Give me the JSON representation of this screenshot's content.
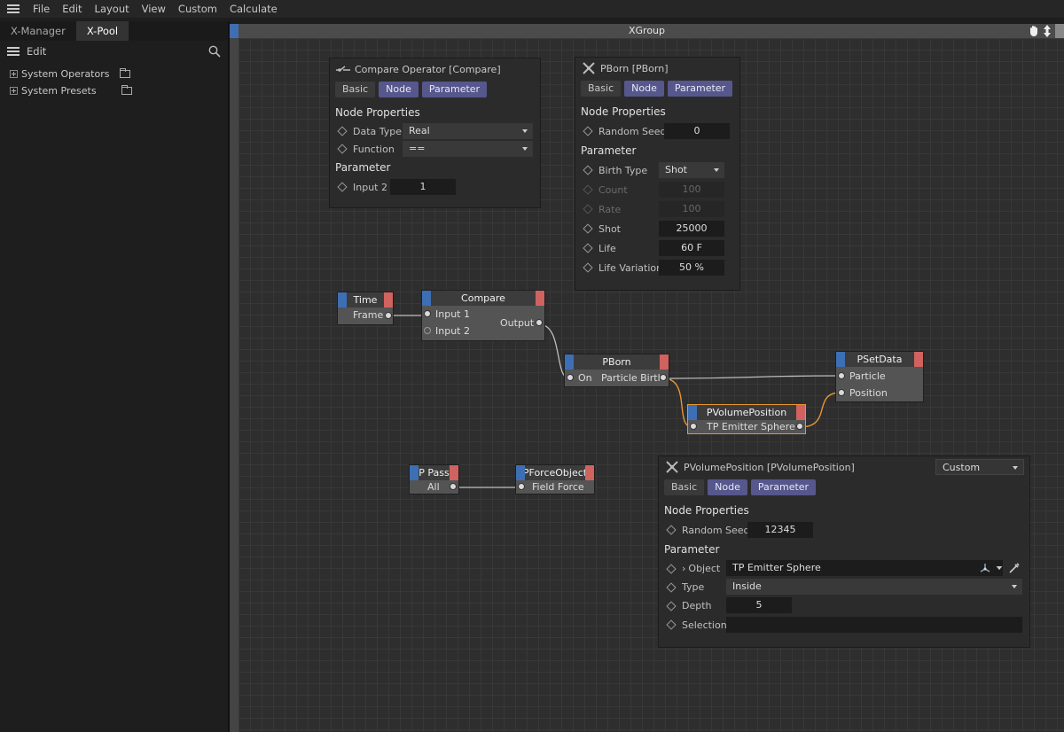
{
  "menubar": {
    "items": [
      "File",
      "Edit",
      "Layout",
      "View",
      "Custom",
      "Calculate"
    ]
  },
  "left": {
    "tabs": [
      "X-Manager",
      "X-Pool"
    ],
    "edit_label": "Edit",
    "tree": [
      "System Operators",
      "System Presets"
    ]
  },
  "xgroup": {
    "title": "XGroup"
  },
  "compare_panel": {
    "title": "Compare Operator [Compare]",
    "tabs": [
      "Basic",
      "Node",
      "Parameter"
    ],
    "section1": "Node Properties",
    "data_type_label": "Data Type",
    "data_type_value": "Real",
    "function_label": "Function",
    "function_value": "==",
    "section2": "Parameter",
    "input2_label": "Input 2",
    "input2_value": "1"
  },
  "pborn_panel": {
    "title": "PBorn [PBorn]",
    "tabs": [
      "Basic",
      "Node",
      "Parameter"
    ],
    "section1": "Node Properties",
    "seed_label": "Random Seed",
    "seed_value": "0",
    "section2": "Parameter",
    "birth_type_label": "Birth Type",
    "birth_type_value": "Shot",
    "count_label": "Count",
    "count_value": "100",
    "rate_label": "Rate",
    "rate_value": "100",
    "shot_label": "Shot",
    "shot_value": "25000",
    "life_label": "Life",
    "life_value": "60 F",
    "lifevar_label": "Life Variation",
    "lifevar_value": "50 %"
  },
  "pvol_panel": {
    "title": "PVolumePosition [PVolumePosition]",
    "mode_value": "Custom",
    "tabs": [
      "Basic",
      "Node",
      "Parameter"
    ],
    "section1": "Node Properties",
    "seed_label": "Random Seed",
    "seed_value": "12345",
    "section2": "Parameter",
    "object_label": "Object",
    "object_value": "TP Emitter Sphere",
    "type_label": "Type",
    "type_value": "Inside",
    "depth_label": "Depth",
    "depth_value": "5",
    "selection_label": "Selection",
    "selection_value": ""
  },
  "nodes": {
    "time": {
      "title": "Time",
      "out": "Frame"
    },
    "compare": {
      "title": "Compare",
      "in1": "Input 1",
      "in2": "Input 2",
      "out": "Output"
    },
    "pborn": {
      "title": "PBorn",
      "in": "On",
      "out": "Particle Birth"
    },
    "psetdata": {
      "title": "PSetData",
      "in1": "Particle",
      "in2": "Position"
    },
    "pvolume": {
      "title": "PVolumePosition",
      "label": "TP Emitter Sphere"
    },
    "ppass": {
      "title": "P Pass",
      "out": "All"
    },
    "pforce": {
      "title": "PForceObject",
      "in": "Field Force"
    }
  },
  "colors": {
    "port_left": "#3d6fb4",
    "port_right": "#d0625f",
    "tab_active": "#56578c",
    "selected_wire": "#e8962f"
  }
}
